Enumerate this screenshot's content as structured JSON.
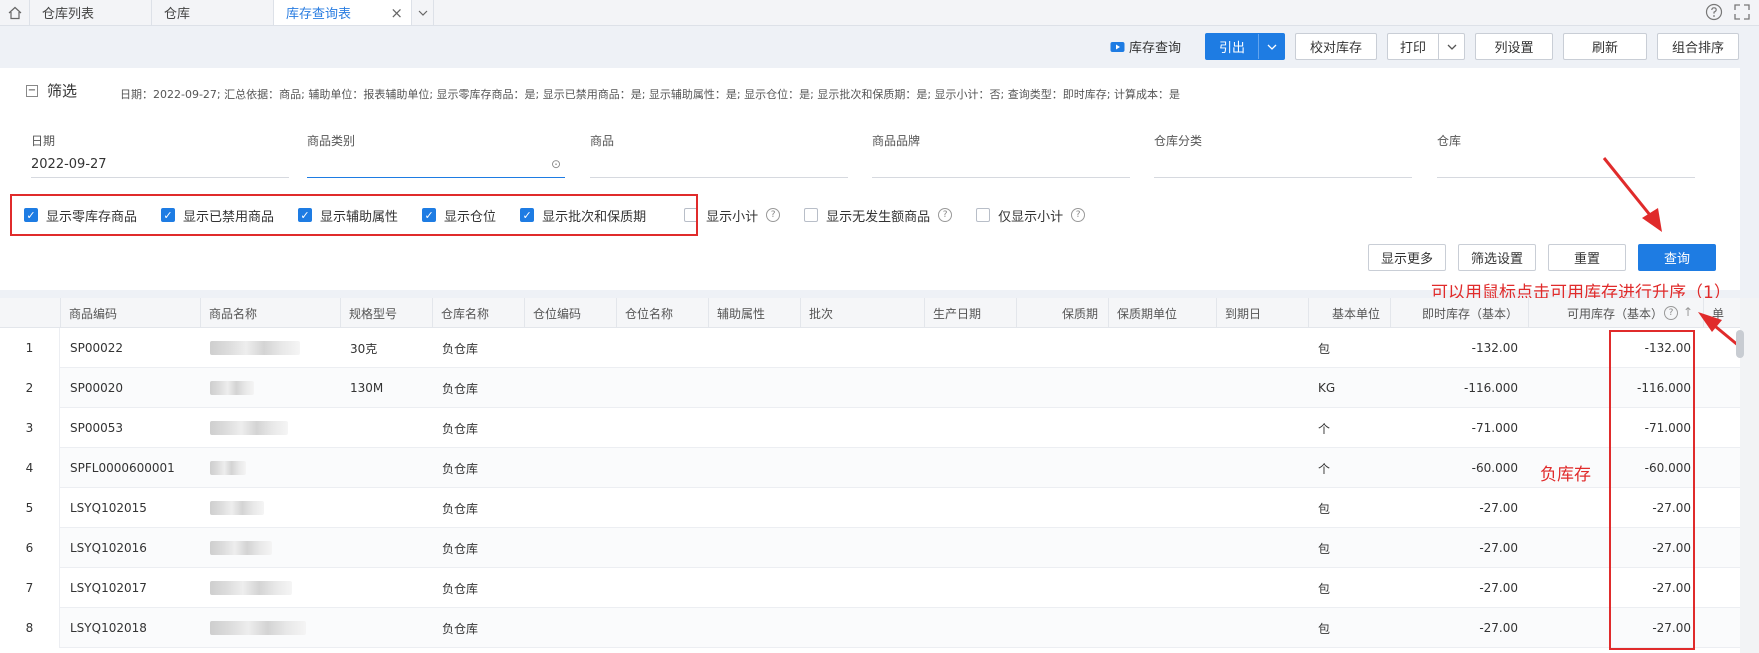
{
  "tabs": {
    "home_icon": "home-icon",
    "items": [
      {
        "label": "仓库列表"
      },
      {
        "label": "仓库"
      },
      {
        "label": "库存查询表"
      }
    ]
  },
  "toolbar": {
    "video_link": "库存查询",
    "export": "引出",
    "verify": "校对库存",
    "print": "打印",
    "column_settings": "列设置",
    "refresh": "刷新",
    "combo_sort": "组合排序"
  },
  "filter": {
    "title": "筛选",
    "summary": "日期：2022-09-27; 汇总依据：商品; 辅助单位：报表辅助单位; 显示零库存商品：是; 显示已禁用商品：是; 显示辅助属性：是; 显示仓位：是; 显示批次和保质期：是; 显示小计：否; 查询类型：即时库存; 计算成本：是",
    "fields": [
      {
        "label": "日期",
        "value": "2022-09-27"
      },
      {
        "label": "商品类别",
        "value": ""
      },
      {
        "label": "商品",
        "value": ""
      },
      {
        "label": "商品品牌",
        "value": ""
      },
      {
        "label": "仓库分类",
        "value": ""
      },
      {
        "label": "仓库",
        "value": ""
      }
    ],
    "checkboxes": [
      {
        "label": "显示零库存商品",
        "checked": true
      },
      {
        "label": "显示已禁用商品",
        "checked": true
      },
      {
        "label": "显示辅助属性",
        "checked": true
      },
      {
        "label": "显示仓位",
        "checked": true
      },
      {
        "label": "显示批次和保质期",
        "checked": true
      },
      {
        "label": "显示小计",
        "checked": false
      },
      {
        "label": "显示无发生额商品",
        "checked": false
      },
      {
        "label": "仅显示小计",
        "checked": false
      }
    ],
    "buttons": {
      "more": "显示更多",
      "settings": "筛选设置",
      "reset": "重置",
      "query": "查询"
    }
  },
  "annotations": {
    "sort_hint": "可以用鼠标点击可用库存进行升序（1）",
    "negative_label": "负库存"
  },
  "table": {
    "columns": [
      "商品编码",
      "商品名称",
      "规格型号",
      "仓库名称",
      "仓位编码",
      "仓位名称",
      "辅助属性",
      "批次",
      "生产日期",
      "保质期",
      "保质期单位",
      "到期日",
      "基本单位",
      "即时库存（基本）",
      "可用库存（基本）",
      "单"
    ],
    "rows": [
      {
        "no": "1",
        "code": "SP00022",
        "spec": "30克",
        "warehouse": "负仓库",
        "unit": "包",
        "instant": "-132.00",
        "available": "-132.00"
      },
      {
        "no": "2",
        "code": "SP00020",
        "spec": "130M",
        "warehouse": "负仓库",
        "unit": "KG",
        "instant": "-116.000",
        "available": "-116.000"
      },
      {
        "no": "3",
        "code": "SP00053",
        "spec": "",
        "warehouse": "负仓库",
        "unit": "个",
        "instant": "-71.000",
        "available": "-71.000"
      },
      {
        "no": "4",
        "code": "SPFL0000600001",
        "spec": "",
        "warehouse": "负仓库",
        "unit": "个",
        "instant": "-60.000",
        "available": "-60.000"
      },
      {
        "no": "5",
        "code": "LSYQ102015",
        "spec": "",
        "warehouse": "负仓库",
        "unit": "包",
        "instant": "-27.00",
        "available": "-27.00"
      },
      {
        "no": "6",
        "code": "LSYQ102016",
        "spec": "",
        "warehouse": "负仓库",
        "unit": "包",
        "instant": "-27.00",
        "available": "-27.00"
      },
      {
        "no": "7",
        "code": "LSYQ102017",
        "spec": "",
        "warehouse": "负仓库",
        "unit": "包",
        "instant": "-27.00",
        "available": "-27.00"
      },
      {
        "no": "8",
        "code": "LSYQ102018",
        "spec": "",
        "warehouse": "负仓库",
        "unit": "包",
        "instant": "-27.00",
        "available": "-27.00"
      }
    ]
  },
  "colors": {
    "accent": "#1e7ce3",
    "annotation": "#e02b2b"
  }
}
